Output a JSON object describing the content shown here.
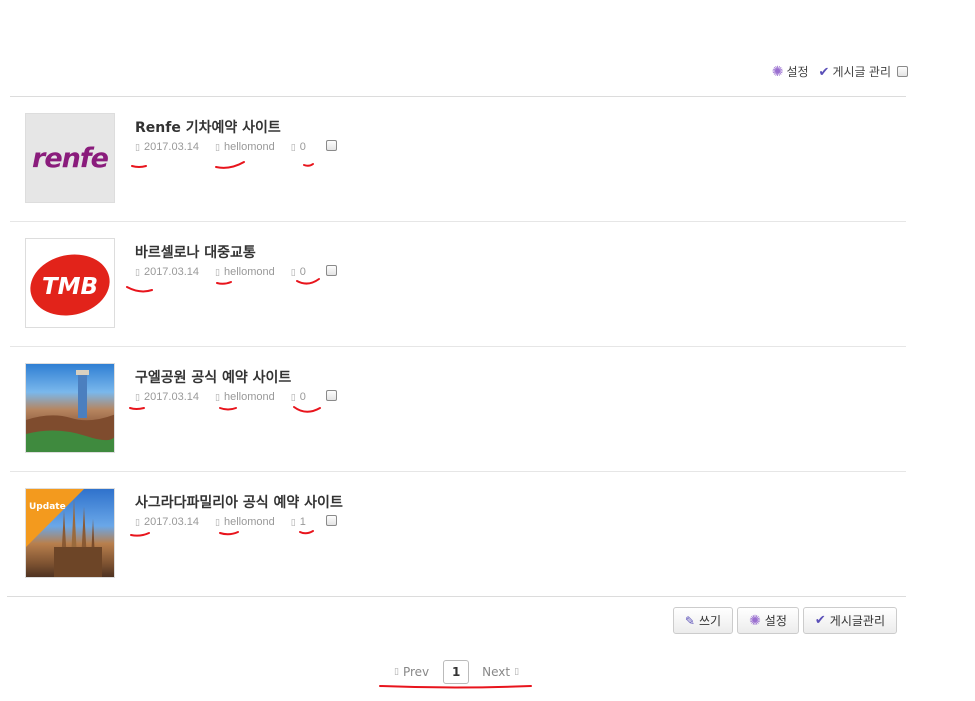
{
  "top_tools": {
    "settings_label": "설정",
    "manage_label": "게시글 관리"
  },
  "posts": [
    {
      "title": "Renfe 기차예약 사이트",
      "date": "2017.03.14",
      "author": "hellomond",
      "comments": "0",
      "thumb_text": "renfe"
    },
    {
      "title": "바르셀로나 대중교통",
      "date": "2017.03.14",
      "author": "hellomond",
      "comments": "0",
      "thumb_text": "TMB"
    },
    {
      "title": "구엘공원 공식 예약 사이트",
      "date": "2017.03.14",
      "author": "hellomond",
      "comments": "0"
    },
    {
      "title": "사그라다파밀리아 공식 예약 사이트",
      "date": "2017.03.14",
      "author": "hellomond",
      "comments": "1",
      "badge": "Update"
    }
  ],
  "bottom_actions": {
    "write_label": "쓰기",
    "settings_label": "설정",
    "manage_label": "게시글관리"
  },
  "pagination": {
    "prev_label": "Prev",
    "current_page": "1",
    "next_label": "Next"
  },
  "colors": {
    "annotation": "#e8141c",
    "renfe_brand": "#8a1c7c",
    "tmb_brand": "#e2231a"
  },
  "icons": {
    "settings": "gear-icon",
    "manage": "check-icon",
    "write": "pencil-icon",
    "date": "calendar-icon",
    "author": "user-icon",
    "comments": "comment-icon"
  }
}
